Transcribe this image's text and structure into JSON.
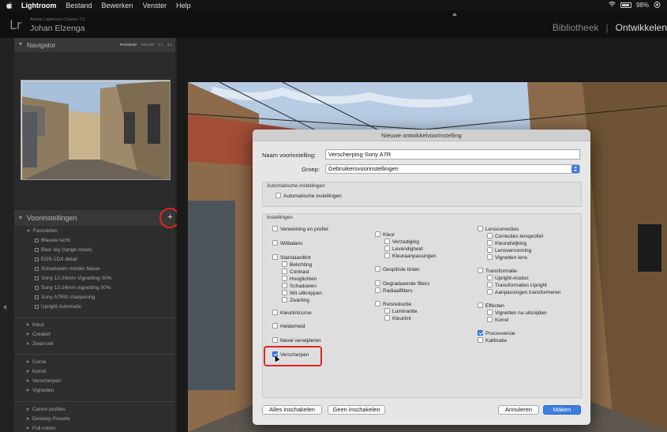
{
  "menubar": {
    "app": "Lightroom",
    "items": [
      "Bestand",
      "Bewerken",
      "Venster",
      "Help"
    ],
    "battery": "98%"
  },
  "identity": {
    "logo": "Lr",
    "product": "Adobe Lightroom Classic CC",
    "user": "Johan Elzenga"
  },
  "modules": {
    "library": "Bibliotheek",
    "develop": "Ontwikkelen"
  },
  "navigator": {
    "title": "Navigator",
    "zoom": [
      "PASSEND",
      "VULLEN",
      "1:1",
      "3:1"
    ]
  },
  "presets": {
    "title": "Voorinstellingen",
    "add": "+",
    "favorites_label": "Favorieten",
    "favorites": [
      "Blauwe lucht",
      "Blue sky (range mask)",
      "EOS-1DX detail",
      "Schaduwen minder blauw",
      "Sony 12-24mm Vignetting 00%",
      "Sony 12-24mm vignetting 50%",
      "Sony A7RIII sharpening",
      "Upright Automatic"
    ],
    "groups_a": [
      "Kleur",
      "Creatief",
      "Zwart-wit"
    ],
    "groups_b": [
      "Curve",
      "Korrel",
      "Verscherpen",
      "Vignetten"
    ],
    "groups_c": [
      "Canon profiles",
      "Develop Presets",
      "Full colors"
    ]
  },
  "dialog": {
    "title": "Nieuwe ontwikkelvoorinstelling",
    "name_label": "Naam voorinstelling:",
    "name_value": "Verscherping Sony A7R",
    "group_label": "Groep:",
    "group_value": "Gebruikersvoorinstellingen",
    "auto_title": "Automatische instellingen",
    "auto_checkbox": "Automatische instellingen",
    "settings_title": "Instellingen",
    "col1": {
      "verwerking": "Verwerking en profiel",
      "witbalans": "Witbalans",
      "standaardtint": "Standaardtint",
      "belichting": "Belichting",
      "contrast": "Contrast",
      "hooglichten": "Hooglichten",
      "schaduwen": "Schaduwen",
      "wit": "Wit uitknippen",
      "zwarting": "Zwarting",
      "kleurtintcurve": "Kleurtintcurve",
      "helderheid": "Helderheid",
      "nevel": "Nevel verwijderen",
      "verscherpen": "Verscherpen"
    },
    "col2": {
      "kleur": "Kleur",
      "verzadiging": "Verzadiging",
      "levendigheid": "Levendigheid",
      "kleuraanpassingen": "Kleuraanpassingen",
      "gesplitste": "Gesplitste tinten",
      "gegradueerde": "Gegradueerde filters",
      "radiaal": "Radiaalfilters",
      "ruisreductie": "Ruisreductie",
      "luminantie": "Luminantie",
      "kleurtint": "Kleurtint"
    },
    "col3": {
      "lenscorrecties": "Lenscorrecties",
      "correcties": "Correcties lensprofiel",
      "kleurafwijking": "Kleurafwijking",
      "lensvervorming": "Lensvervorming",
      "vignetten": "Vignetten lens",
      "transformatie": "Transformatie",
      "upright": "Upright-modus",
      "transformaties": "Transformaties Upright",
      "aanpassingen": "Aanpassingen transformeren",
      "effecten": "Effecten",
      "vignetten_na": "Vignetten na uitsnijden",
      "korrel": "Korrel",
      "procesversie": "Procesversie",
      "kalibratie": "Kalibratie"
    },
    "buttons": {
      "all": "Alles inschakelen",
      "none": "Geen inschakelen",
      "cancel": "Annuleren",
      "create": "Maken"
    },
    "checked": [
      "Procesversie",
      "Verscherpen"
    ]
  }
}
